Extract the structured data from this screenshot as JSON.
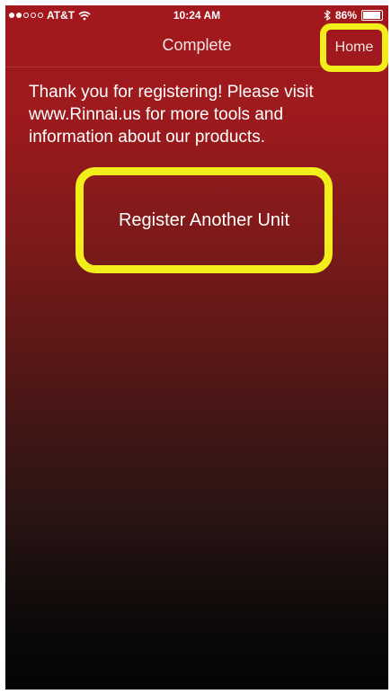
{
  "status_bar": {
    "carrier": "AT&T",
    "time": "10:24 AM",
    "battery": "86%",
    "signal_bars_filled": 2,
    "signal_bars_total": 5
  },
  "nav": {
    "title": "Complete",
    "home_label": "Home"
  },
  "main": {
    "message": "Thank you for registering! Please visit www.Rinnai.us for more tools and information about our products.",
    "register_button_label": "Register Another Unit"
  },
  "colors": {
    "header_red": "#a3181c",
    "highlight_yellow": "#f2ee1c",
    "bottom_black": "#050404"
  }
}
